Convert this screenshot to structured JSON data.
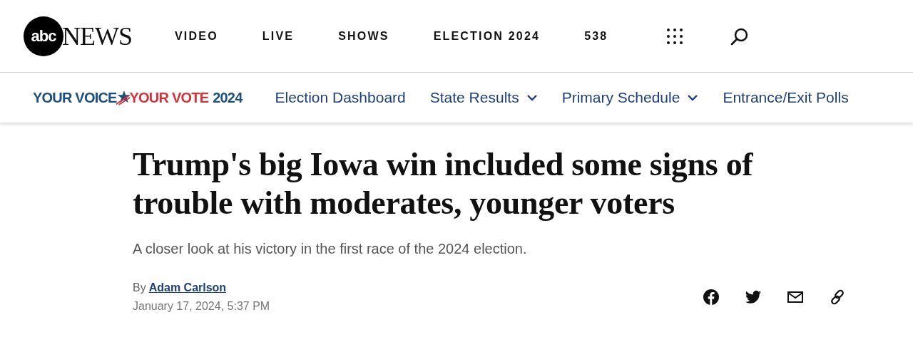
{
  "header": {
    "logo": {
      "mark": "abc",
      "wordmark": "NEWS"
    },
    "nav": [
      {
        "label": "VIDEO"
      },
      {
        "label": "LIVE"
      },
      {
        "label": "SHOWS"
      },
      {
        "label": "ELECTION 2024"
      },
      {
        "label": "538"
      }
    ]
  },
  "election_bar": {
    "logo": {
      "left": "YOUR VOICE",
      "right": "YOUR VOTE",
      "year": "2024"
    },
    "links": [
      {
        "label": "Election Dashboard",
        "kind": "link"
      },
      {
        "label": "State Results",
        "kind": "dropdown"
      },
      {
        "label": "Primary Schedule",
        "kind": "dropdown"
      },
      {
        "label": "Entrance/Exit Polls",
        "kind": "link"
      }
    ]
  },
  "article": {
    "headline": "Trump's big Iowa win included some signs of trouble with moderates, younger voters",
    "subheadline": "A closer look at his victory in the first race of the 2024 election.",
    "byline_prefix": "By",
    "author": "Adam Carlson",
    "date": "January 17, 2024, 5:37 PM",
    "share": [
      {
        "kind": "facebook"
      },
      {
        "kind": "twitter"
      },
      {
        "kind": "email"
      },
      {
        "kind": "link"
      }
    ]
  }
}
